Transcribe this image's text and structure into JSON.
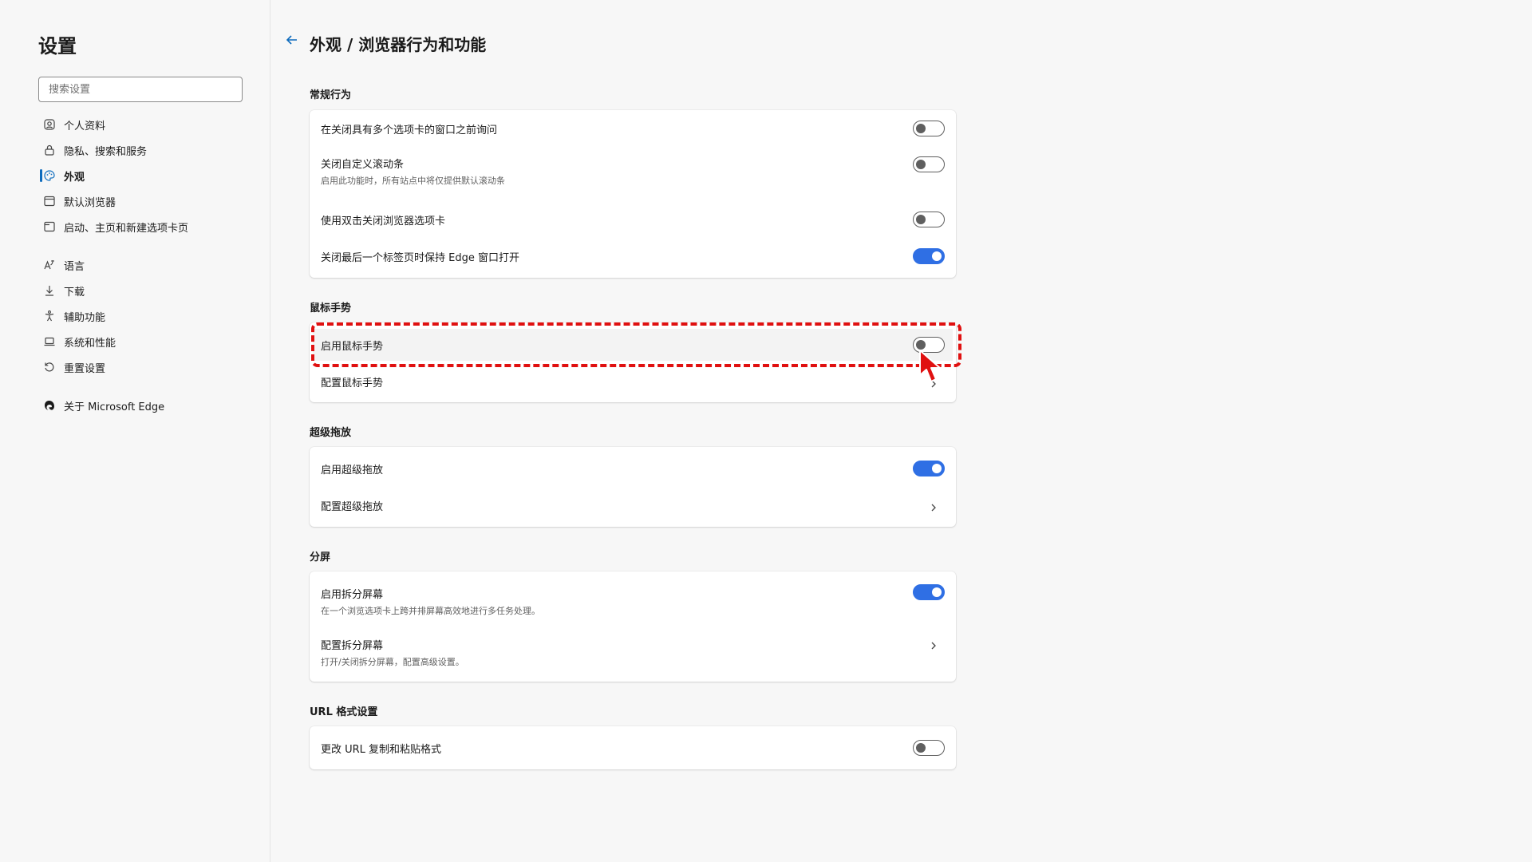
{
  "sidebar": {
    "title": "设置",
    "search_placeholder": "搜索设置",
    "items": [
      {
        "label": "个人资料"
      },
      {
        "label": "隐私、搜索和服务"
      },
      {
        "label": "外观"
      },
      {
        "label": "默认浏览器"
      },
      {
        "label": "启动、主页和新建选项卡页"
      },
      {
        "label": "语言"
      },
      {
        "label": "下载"
      },
      {
        "label": "辅助功能"
      },
      {
        "label": "系统和性能"
      },
      {
        "label": "重置设置"
      },
      {
        "label": "关于 Microsoft Edge"
      }
    ]
  },
  "main": {
    "title": "外观 / 浏览器行为和功能",
    "sections": [
      {
        "title": "常规行为",
        "rows": [
          {
            "label": "在关闭具有多个选项卡的窗口之前询问",
            "desc": "",
            "state": "off"
          },
          {
            "label": "关闭自定义滚动条",
            "desc": "启用此功能时，所有站点中将仅提供默认滚动条",
            "state": "off"
          },
          {
            "label": "使用双击关闭浏览器选项卡",
            "desc": "",
            "state": "off"
          },
          {
            "label": "关闭最后一个标签页时保持 Edge 窗口打开",
            "desc": "",
            "state": "on"
          }
        ]
      },
      {
        "title": "鼠标手势",
        "rows": [
          {
            "label": "启用鼠标手势",
            "desc": "",
            "state": "off"
          },
          {
            "label": "配置鼠标手势",
            "desc": "",
            "state": "chevron"
          }
        ]
      },
      {
        "title": "超级拖放",
        "rows": [
          {
            "label": "启用超级拖放",
            "desc": "",
            "state": "on"
          },
          {
            "label": "配置超级拖放",
            "desc": "",
            "state": "chevron"
          }
        ]
      },
      {
        "title": "分屏",
        "rows": [
          {
            "label": "启用拆分屏幕",
            "desc": "在一个浏览选项卡上跨并排屏幕高效地进行多任务处理。",
            "state": "on"
          },
          {
            "label": "配置拆分屏幕",
            "desc": "打开/关闭拆分屏幕，配置高级设置。",
            "state": "chevron"
          }
        ]
      },
      {
        "title": "URL 格式设置",
        "rows": [
          {
            "label": "更改 URL 复制和粘贴格式",
            "desc": "",
            "state": "off"
          }
        ]
      }
    ]
  },
  "colors": {
    "accent": "#2f6fe4",
    "highlight": "#e01010"
  }
}
